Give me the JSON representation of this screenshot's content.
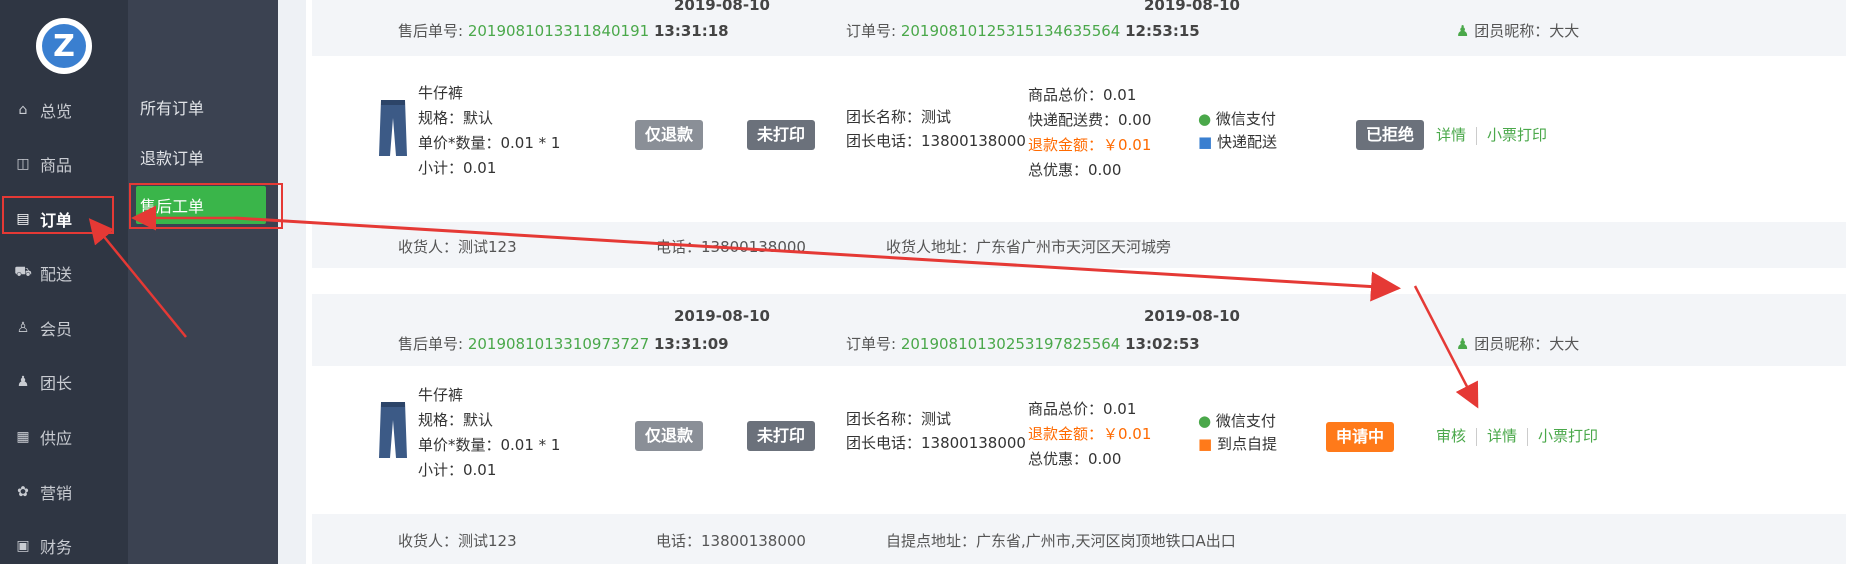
{
  "sidebar": {
    "items": [
      {
        "icon": "home-icon",
        "glyph": "⌂",
        "label": "总览"
      },
      {
        "icon": "goods-icon",
        "glyph": "◫",
        "label": "商品"
      },
      {
        "icon": "order-icon",
        "glyph": "▤",
        "label": "订单"
      },
      {
        "icon": "delivery-icon",
        "glyph": "⛟",
        "label": "配送"
      },
      {
        "icon": "member-icon",
        "glyph": "♙",
        "label": "会员"
      },
      {
        "icon": "leader-icon",
        "glyph": "♟",
        "label": "团长"
      },
      {
        "icon": "supply-icon",
        "glyph": "▦",
        "label": "供应"
      },
      {
        "icon": "marketing-icon",
        "glyph": "✿",
        "label": "营销"
      },
      {
        "icon": "finance-icon",
        "glyph": "▣",
        "label": "财务"
      }
    ]
  },
  "subnav": {
    "items": [
      "所有订单",
      "退款订单"
    ],
    "active": "售后工单"
  },
  "orders": [
    {
      "aftersale_label": "售后单号:",
      "aftersale_no": "2019081013311840191",
      "aftersale_date": "2019-08-10",
      "aftersale_time": "13:31:18",
      "order_label": "订单号:",
      "order_no": "2019081012531513463556​4",
      "order_date": "2019-08-10",
      "order_time": "12:53:15",
      "nickname": "团员昵称：大大",
      "product_name": "牛仔裤",
      "spec": "规格：默认",
      "price_qty": "单价*数量：0.01 * 1",
      "subtotal": "小计：0.01",
      "refund_type": "仅退款",
      "print_status": "未打印",
      "leader_name": "团长名称：测试",
      "leader_phone": "团长电话：13800138000",
      "total": "商品总价：0.01",
      "shipping": "快递配送费：0.00",
      "refund": "退款金额：￥0.01",
      "discount": "总优惠：0.00",
      "pay": "微信支付",
      "delivery": "快递配送",
      "status": "已拒绝",
      "actions": [
        "详情",
        "小票打印"
      ],
      "receiver": "收货人：测试123",
      "phone": "电话：13800138000",
      "address": "收货人地址：广东省广州市天河区天河城旁"
    },
    {
      "aftersale_label": "售后单号:",
      "aftersale_no": "2019081013310973727",
      "aftersale_date": "2019-08-10",
      "aftersale_time": "13:31:09",
      "order_label": "订单号:",
      "order_no": "2019081013025319782556​4",
      "order_date": "2019-08-10",
      "order_time": "13:02:53",
      "nickname": "团员昵称：大大",
      "product_name": "牛仔裤",
      "spec": "规格：默认",
      "price_qty": "单价*数量：0.01 * 1",
      "subtotal": "小计：0.01",
      "refund_type": "仅退款",
      "print_status": "未打印",
      "leader_name": "团长名称：测试",
      "leader_phone": "团长电话：13800138000",
      "total": "商品总价：0.01",
      "refund": "退款金额：￥0.01",
      "discount": "总优惠：0.00",
      "pay": "微信支付",
      "delivery": "到点自提",
      "status": "申请中",
      "actions": [
        "审核",
        "详情",
        "小票打印"
      ],
      "receiver": "收货人：测试123",
      "phone": "电话：13800138000",
      "address": "自提点地址：广东省,广州市,天河区岗顶地铁口A出口"
    }
  ]
}
